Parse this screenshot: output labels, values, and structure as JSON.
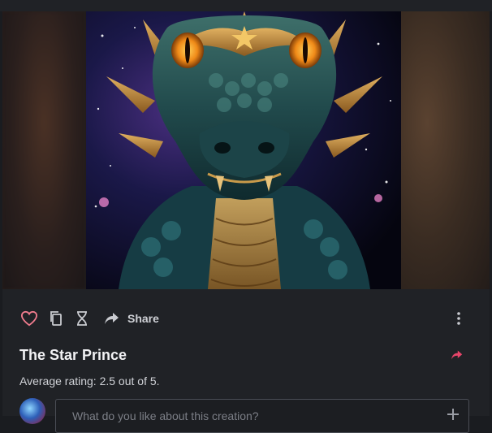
{
  "post": {
    "title": "The Star Prince",
    "rating_text": "Average rating: 2.5 out of 5."
  },
  "actions": {
    "share_label": "Share"
  },
  "comment": {
    "placeholder": "What do you like about this creation?"
  },
  "colors": {
    "accent_like": "#f07c8e",
    "accent_share": "#e8456a",
    "background": "#1a1c20"
  },
  "icons": [
    "heart-icon",
    "copy-icon",
    "hourglass-icon",
    "share-arrow-icon",
    "more-vertical-icon",
    "share-forward-icon",
    "plus-icon"
  ]
}
